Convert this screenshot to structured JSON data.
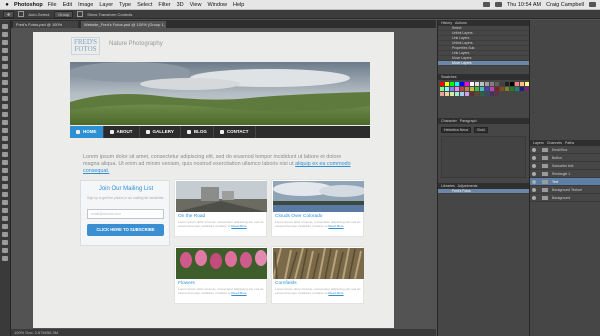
{
  "menubar": {
    "app": "Photoshop",
    "items": [
      "File",
      "Edit",
      "Image",
      "Layer",
      "Type",
      "Select",
      "Filter",
      "3D",
      "View",
      "Window",
      "Help"
    ],
    "clock": "Thu 10:54 AM",
    "user": "Craig Campbell"
  },
  "options_bar": {
    "auto_select": "Auto-Select:",
    "group": "Group",
    "show_transform": "Show Transform Controls"
  },
  "doc_tabs": [
    "Fred's Fotos.psd @ 100%",
    "Website_Fred's Fotos.psd @ 100% (Group 1, RGB/8)"
  ],
  "status": "100%   Doc: 2.67M/56.3M",
  "site": {
    "logo_line1": "FRED'S",
    "logo_line2": "FOTOS",
    "tagline": "Nature Photography",
    "nav": [
      "HOME",
      "ABOUT",
      "GALLERY",
      "BLOG",
      "CONTACT"
    ],
    "nav_icons": [
      "home-icon",
      "user-icon",
      "camera-icon",
      "pencil-icon",
      "envelope-icon"
    ],
    "lorem": "Lorem ipsum dolor sit amet, consectetur adipiscing elit, sed do eiusmod tempor incididunt ut labore et dolore magna aliqua. Ut enim ad minim veniam, quis nostrud exercitation ullamco laboris nisi ut",
    "lorem_link": "aliquip ex ea commodo consequat.",
    "signup": {
      "title": "Join Our Mailing List",
      "text": "Sign up to get free photos in our mailing list newsletter.",
      "placeholder": "email@domain.com",
      "button": "CLICK HERE TO SUBSCRIBE"
    },
    "cards": [
      {
        "title": "On the Road",
        "desc": "Lorem ipsum dolor sit amet, consectetur adipiscing elit, sed do eiusmod tempor incididunt ut labore et",
        "more": "Read More"
      },
      {
        "title": "Clouds Over Colorado",
        "desc": "Lorem ipsum dolor sit amet, consectetur adipiscing elit, sed do eiusmod tempor incididunt ut labore et",
        "more": "Read More"
      },
      {
        "title": "Flowers",
        "desc": "Lorem ipsum dolor sit amet, consectetur adipiscing elit, sed do eiusmod tempor incididunt ut labore et",
        "more": "Read More"
      },
      {
        "title": "Cornfields",
        "desc": "Lorem ipsum dolor sit amet, consectetur adipiscing elit, sed do eiusmod tempor incididunt ut labore et",
        "more": "Read More"
      }
    ]
  },
  "history_panel": {
    "tabs": [
      "History",
      "Actions"
    ],
    "rows": [
      "Select",
      "Unlink Layers",
      "Link Layers",
      "Unlink Layers",
      "Properties Sub.",
      "Link Layers",
      "Move Layers",
      "Move Layers"
    ],
    "selected_index": 7
  },
  "swatch_colors": [
    "#ff0000",
    "#ffff00",
    "#00ff00",
    "#00ffff",
    "#0000ff",
    "#ff00ff",
    "#ffffff",
    "#e0e0e0",
    "#c0c0c0",
    "#a0a0a0",
    "#808080",
    "#606060",
    "#404040",
    "#202020",
    "#000000",
    "#ff8080",
    "#ffc080",
    "#ffff80",
    "#80ff80",
    "#80ffff",
    "#8080ff",
    "#ff80ff",
    "#c04040",
    "#c08040",
    "#c0c040",
    "#40c040",
    "#40c0c0",
    "#4040c0",
    "#c040c0",
    "#802020",
    "#805020",
    "#808020",
    "#208020",
    "#208080",
    "#202080",
    "#802080",
    "#f0a0a0",
    "#f0d0a0",
    "#d0f0a0",
    "#a0f0d0",
    "#a0d0f0",
    "#d0a0f0",
    "#603030",
    "#604830",
    "#306048",
    "#305060",
    "#483060",
    "#603048"
  ],
  "char_panel": {
    "tabs": [
      "Character",
      "Paragraph"
    ],
    "font": "Helvetica Neue",
    "style": "Bold"
  },
  "layers_panel": {
    "tabs": [
      "Layers",
      "Channels",
      "Paths"
    ],
    "rows": [
      "Email Box",
      "Button",
      "Subscribe text",
      "Rectangle 1",
      "Text",
      "Background Texture",
      "Background"
    ],
    "selected_index": 4
  },
  "adjustments": {
    "tabs": [
      "Libraries",
      "Adjustments"
    ],
    "label": "Fred's Fotos"
  }
}
